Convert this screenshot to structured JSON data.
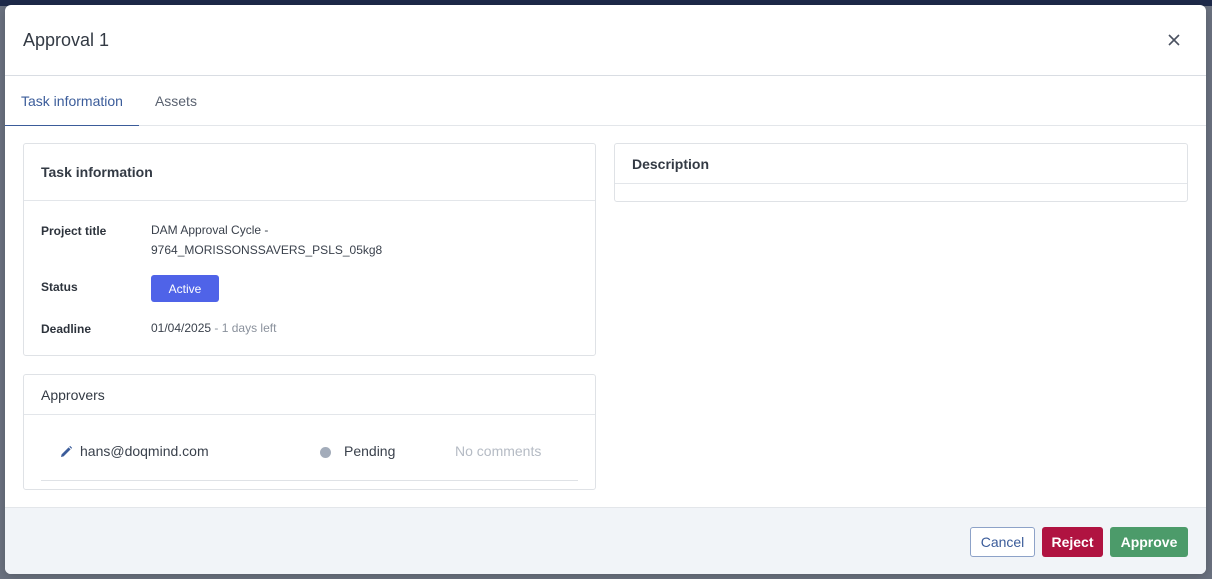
{
  "modal": {
    "title": "Approval 1"
  },
  "tabs": [
    {
      "label": "Task information",
      "active": true
    },
    {
      "label": "Assets",
      "active": false
    }
  ],
  "task_info": {
    "header": "Task information",
    "project_title_label": "Project title",
    "project_title_line1": "DAM Approval Cycle -",
    "project_title_line2": "9764_MORISSONSSAVERS_PSLS_05kg8",
    "status_label": "Status",
    "status_value": "Active",
    "deadline_label": "Deadline",
    "deadline_date": "01/04/2025",
    "deadline_sep": " - ",
    "deadline_remaining": "1 days left"
  },
  "approvers": {
    "header": "Approvers",
    "items": [
      {
        "email": "hans@doqmind.com",
        "status": "Pending",
        "comments": "No comments",
        "icon": "pencil-icon"
      }
    ]
  },
  "description": {
    "header": "Description"
  },
  "footer": {
    "cancel_label": "Cancel",
    "reject_label": "Reject",
    "approve_label": "Approve"
  },
  "colors": {
    "accent": "#3b5c9a",
    "status_active": "#4f63e8",
    "reject": "#b01341",
    "approve": "#4c9b6a"
  }
}
